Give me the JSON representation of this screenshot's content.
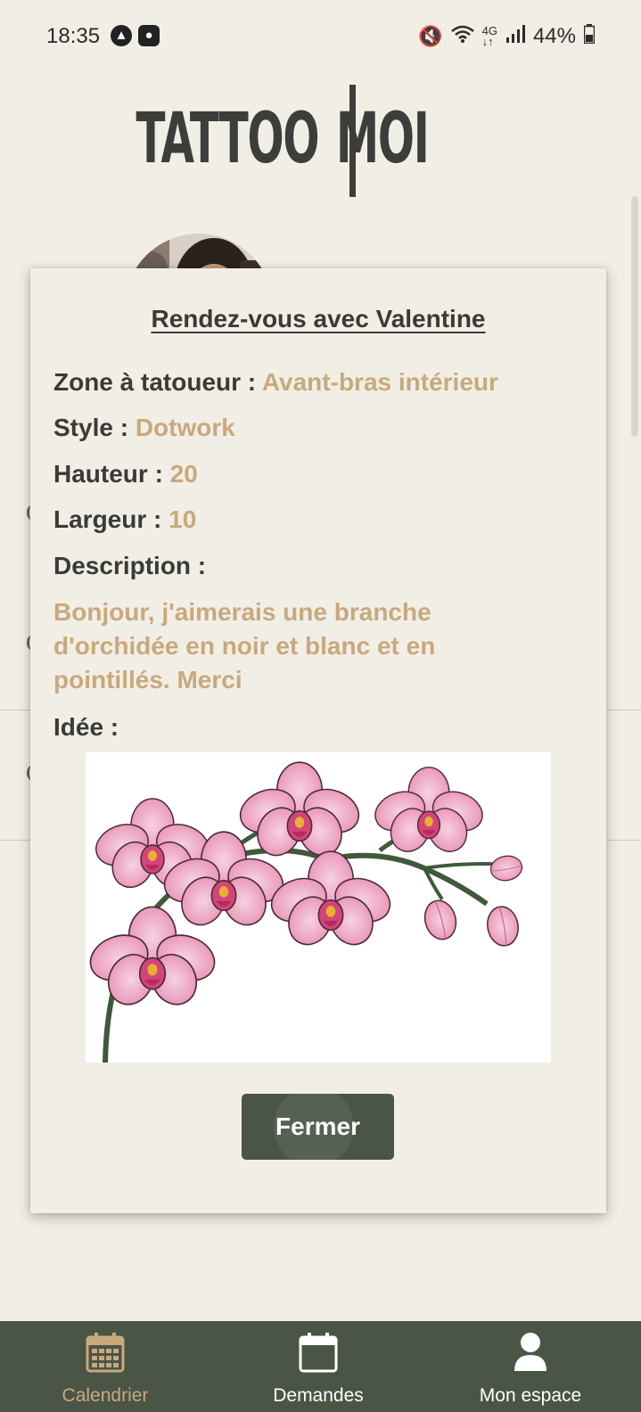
{
  "status_bar": {
    "time": "18:35",
    "battery": "44%"
  },
  "app": {
    "logo_left": "TATTOO",
    "logo_right": "MOI"
  },
  "modal": {
    "title": "Rendez-vous avec Valentine",
    "zone_label": "Zone à tatoueur : ",
    "zone_value": "Avant-bras intérieur",
    "style_label": "Style : ",
    "style_value": "Dotwork",
    "height_label": "Hauteur : ",
    "height_value": "20",
    "width_label": "Largeur : ",
    "width_value": "10",
    "description_label": "Description :",
    "description_value": "Bonjour, j'aimerais une branche d'orchidée en noir et blanc et en pointillés. Merci",
    "idea_label": "Idée :",
    "close_label": "Fermer"
  },
  "bottom_nav": [
    {
      "label": "Calendrier",
      "icon": "calendar-grid-icon",
      "active": true
    },
    {
      "label": "Demandes",
      "icon": "calendar-icon",
      "active": false
    },
    {
      "label": "Mon espace",
      "icon": "user-icon",
      "active": false
    }
  ],
  "colors": {
    "background": "#f1eee6",
    "accent": "#c8a97c",
    "primary": "#4a5546",
    "text": "#3a3a37"
  }
}
